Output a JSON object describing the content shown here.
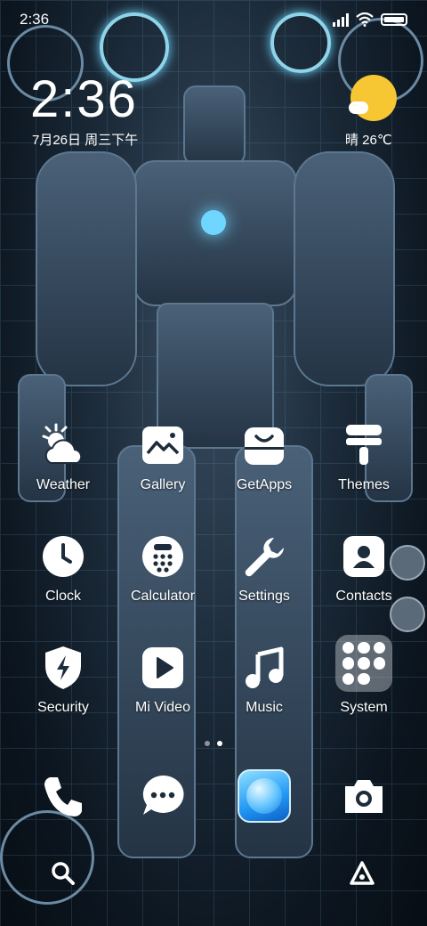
{
  "status_bar": {
    "time": "2:36",
    "battery": "battery-full"
  },
  "clock_widget": {
    "time": "2:36",
    "date": "7月26日 周三下午",
    "weather_text": "晴 26℃",
    "weather_icon": "sun-cloud-icon"
  },
  "apps": [
    {
      "label": "Weather",
      "icon": "weather-icon"
    },
    {
      "label": "Gallery",
      "icon": "gallery-icon"
    },
    {
      "label": "GetApps",
      "icon": "getapps-icon"
    },
    {
      "label": "Themes",
      "icon": "themes-icon"
    },
    {
      "label": "Clock",
      "icon": "clock-icon"
    },
    {
      "label": "Calculator",
      "icon": "calculator-icon"
    },
    {
      "label": "Settings",
      "icon": "settings-icon"
    },
    {
      "label": "Contacts",
      "icon": "contacts-icon"
    },
    {
      "label": "Security",
      "icon": "security-icon"
    },
    {
      "label": "Mi Video",
      "icon": "mi-video-icon"
    },
    {
      "label": "Music",
      "icon": "music-icon"
    },
    {
      "label": "System",
      "icon": "system-folder-icon"
    }
  ],
  "page_indicator": {
    "pages": 2,
    "current": 2
  },
  "dock": [
    {
      "icon": "phone-icon"
    },
    {
      "icon": "messages-icon"
    },
    {
      "icon": "browser-icon"
    },
    {
      "icon": "camera-icon"
    }
  ],
  "bottom": {
    "search_icon": "search-icon",
    "assistant_icon": "assistant-icon"
  },
  "colors": {
    "sun": "#f6c633",
    "browser": "#2196f3"
  }
}
